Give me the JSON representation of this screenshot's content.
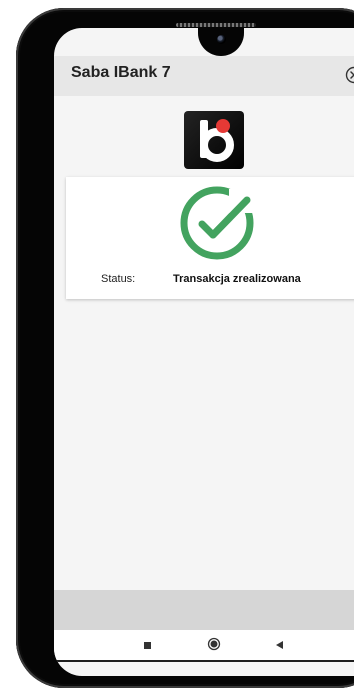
{
  "app": {
    "title": "Saba IBank 7"
  },
  "icons": {
    "close": "close-circle-icon",
    "logo": "bank-logo-icon",
    "success": "check-circle-icon",
    "nav_recents": "square-recents-icon",
    "nav_home": "circle-home-icon",
    "nav_back": "triangle-back-icon"
  },
  "transaction": {
    "status_label": "Status:",
    "status_value": "Transakcja zrealizowana"
  },
  "colors": {
    "success": "#43a35f",
    "logo_dot": "#e53935",
    "header": "#e7e7e7",
    "background": "#f5f5f5"
  }
}
